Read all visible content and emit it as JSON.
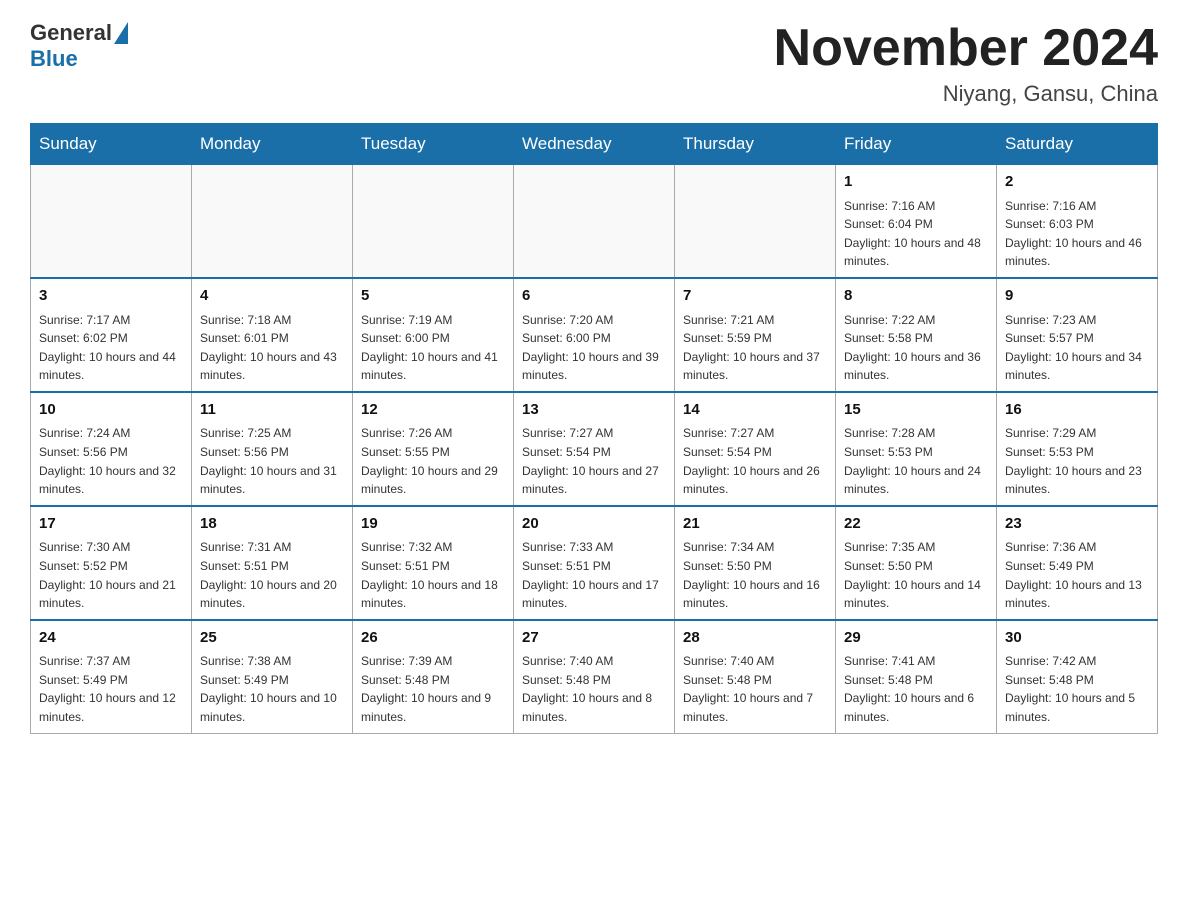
{
  "header": {
    "logo_general": "General",
    "logo_blue": "Blue",
    "title": "November 2024",
    "subtitle": "Niyang, Gansu, China"
  },
  "days_of_week": [
    "Sunday",
    "Monday",
    "Tuesday",
    "Wednesday",
    "Thursday",
    "Friday",
    "Saturday"
  ],
  "weeks": [
    {
      "days": [
        {
          "date": "",
          "sunrise": "",
          "sunset": "",
          "daylight": ""
        },
        {
          "date": "",
          "sunrise": "",
          "sunset": "",
          "daylight": ""
        },
        {
          "date": "",
          "sunrise": "",
          "sunset": "",
          "daylight": ""
        },
        {
          "date": "",
          "sunrise": "",
          "sunset": "",
          "daylight": ""
        },
        {
          "date": "",
          "sunrise": "",
          "sunset": "",
          "daylight": ""
        },
        {
          "date": "1",
          "sunrise": "Sunrise: 7:16 AM",
          "sunset": "Sunset: 6:04 PM",
          "daylight": "Daylight: 10 hours and 48 minutes."
        },
        {
          "date": "2",
          "sunrise": "Sunrise: 7:16 AM",
          "sunset": "Sunset: 6:03 PM",
          "daylight": "Daylight: 10 hours and 46 minutes."
        }
      ]
    },
    {
      "days": [
        {
          "date": "3",
          "sunrise": "Sunrise: 7:17 AM",
          "sunset": "Sunset: 6:02 PM",
          "daylight": "Daylight: 10 hours and 44 minutes."
        },
        {
          "date": "4",
          "sunrise": "Sunrise: 7:18 AM",
          "sunset": "Sunset: 6:01 PM",
          "daylight": "Daylight: 10 hours and 43 minutes."
        },
        {
          "date": "5",
          "sunrise": "Sunrise: 7:19 AM",
          "sunset": "Sunset: 6:00 PM",
          "daylight": "Daylight: 10 hours and 41 minutes."
        },
        {
          "date": "6",
          "sunrise": "Sunrise: 7:20 AM",
          "sunset": "Sunset: 6:00 PM",
          "daylight": "Daylight: 10 hours and 39 minutes."
        },
        {
          "date": "7",
          "sunrise": "Sunrise: 7:21 AM",
          "sunset": "Sunset: 5:59 PM",
          "daylight": "Daylight: 10 hours and 37 minutes."
        },
        {
          "date": "8",
          "sunrise": "Sunrise: 7:22 AM",
          "sunset": "Sunset: 5:58 PM",
          "daylight": "Daylight: 10 hours and 36 minutes."
        },
        {
          "date": "9",
          "sunrise": "Sunrise: 7:23 AM",
          "sunset": "Sunset: 5:57 PM",
          "daylight": "Daylight: 10 hours and 34 minutes."
        }
      ]
    },
    {
      "days": [
        {
          "date": "10",
          "sunrise": "Sunrise: 7:24 AM",
          "sunset": "Sunset: 5:56 PM",
          "daylight": "Daylight: 10 hours and 32 minutes."
        },
        {
          "date": "11",
          "sunrise": "Sunrise: 7:25 AM",
          "sunset": "Sunset: 5:56 PM",
          "daylight": "Daylight: 10 hours and 31 minutes."
        },
        {
          "date": "12",
          "sunrise": "Sunrise: 7:26 AM",
          "sunset": "Sunset: 5:55 PM",
          "daylight": "Daylight: 10 hours and 29 minutes."
        },
        {
          "date": "13",
          "sunrise": "Sunrise: 7:27 AM",
          "sunset": "Sunset: 5:54 PM",
          "daylight": "Daylight: 10 hours and 27 minutes."
        },
        {
          "date": "14",
          "sunrise": "Sunrise: 7:27 AM",
          "sunset": "Sunset: 5:54 PM",
          "daylight": "Daylight: 10 hours and 26 minutes."
        },
        {
          "date": "15",
          "sunrise": "Sunrise: 7:28 AM",
          "sunset": "Sunset: 5:53 PM",
          "daylight": "Daylight: 10 hours and 24 minutes."
        },
        {
          "date": "16",
          "sunrise": "Sunrise: 7:29 AM",
          "sunset": "Sunset: 5:53 PM",
          "daylight": "Daylight: 10 hours and 23 minutes."
        }
      ]
    },
    {
      "days": [
        {
          "date": "17",
          "sunrise": "Sunrise: 7:30 AM",
          "sunset": "Sunset: 5:52 PM",
          "daylight": "Daylight: 10 hours and 21 minutes."
        },
        {
          "date": "18",
          "sunrise": "Sunrise: 7:31 AM",
          "sunset": "Sunset: 5:51 PM",
          "daylight": "Daylight: 10 hours and 20 minutes."
        },
        {
          "date": "19",
          "sunrise": "Sunrise: 7:32 AM",
          "sunset": "Sunset: 5:51 PM",
          "daylight": "Daylight: 10 hours and 18 minutes."
        },
        {
          "date": "20",
          "sunrise": "Sunrise: 7:33 AM",
          "sunset": "Sunset: 5:51 PM",
          "daylight": "Daylight: 10 hours and 17 minutes."
        },
        {
          "date": "21",
          "sunrise": "Sunrise: 7:34 AM",
          "sunset": "Sunset: 5:50 PM",
          "daylight": "Daylight: 10 hours and 16 minutes."
        },
        {
          "date": "22",
          "sunrise": "Sunrise: 7:35 AM",
          "sunset": "Sunset: 5:50 PM",
          "daylight": "Daylight: 10 hours and 14 minutes."
        },
        {
          "date": "23",
          "sunrise": "Sunrise: 7:36 AM",
          "sunset": "Sunset: 5:49 PM",
          "daylight": "Daylight: 10 hours and 13 minutes."
        }
      ]
    },
    {
      "days": [
        {
          "date": "24",
          "sunrise": "Sunrise: 7:37 AM",
          "sunset": "Sunset: 5:49 PM",
          "daylight": "Daylight: 10 hours and 12 minutes."
        },
        {
          "date": "25",
          "sunrise": "Sunrise: 7:38 AM",
          "sunset": "Sunset: 5:49 PM",
          "daylight": "Daylight: 10 hours and 10 minutes."
        },
        {
          "date": "26",
          "sunrise": "Sunrise: 7:39 AM",
          "sunset": "Sunset: 5:48 PM",
          "daylight": "Daylight: 10 hours and 9 minutes."
        },
        {
          "date": "27",
          "sunrise": "Sunrise: 7:40 AM",
          "sunset": "Sunset: 5:48 PM",
          "daylight": "Daylight: 10 hours and 8 minutes."
        },
        {
          "date": "28",
          "sunrise": "Sunrise: 7:40 AM",
          "sunset": "Sunset: 5:48 PM",
          "daylight": "Daylight: 10 hours and 7 minutes."
        },
        {
          "date": "29",
          "sunrise": "Sunrise: 7:41 AM",
          "sunset": "Sunset: 5:48 PM",
          "daylight": "Daylight: 10 hours and 6 minutes."
        },
        {
          "date": "30",
          "sunrise": "Sunrise: 7:42 AM",
          "sunset": "Sunset: 5:48 PM",
          "daylight": "Daylight: 10 hours and 5 minutes."
        }
      ]
    }
  ]
}
